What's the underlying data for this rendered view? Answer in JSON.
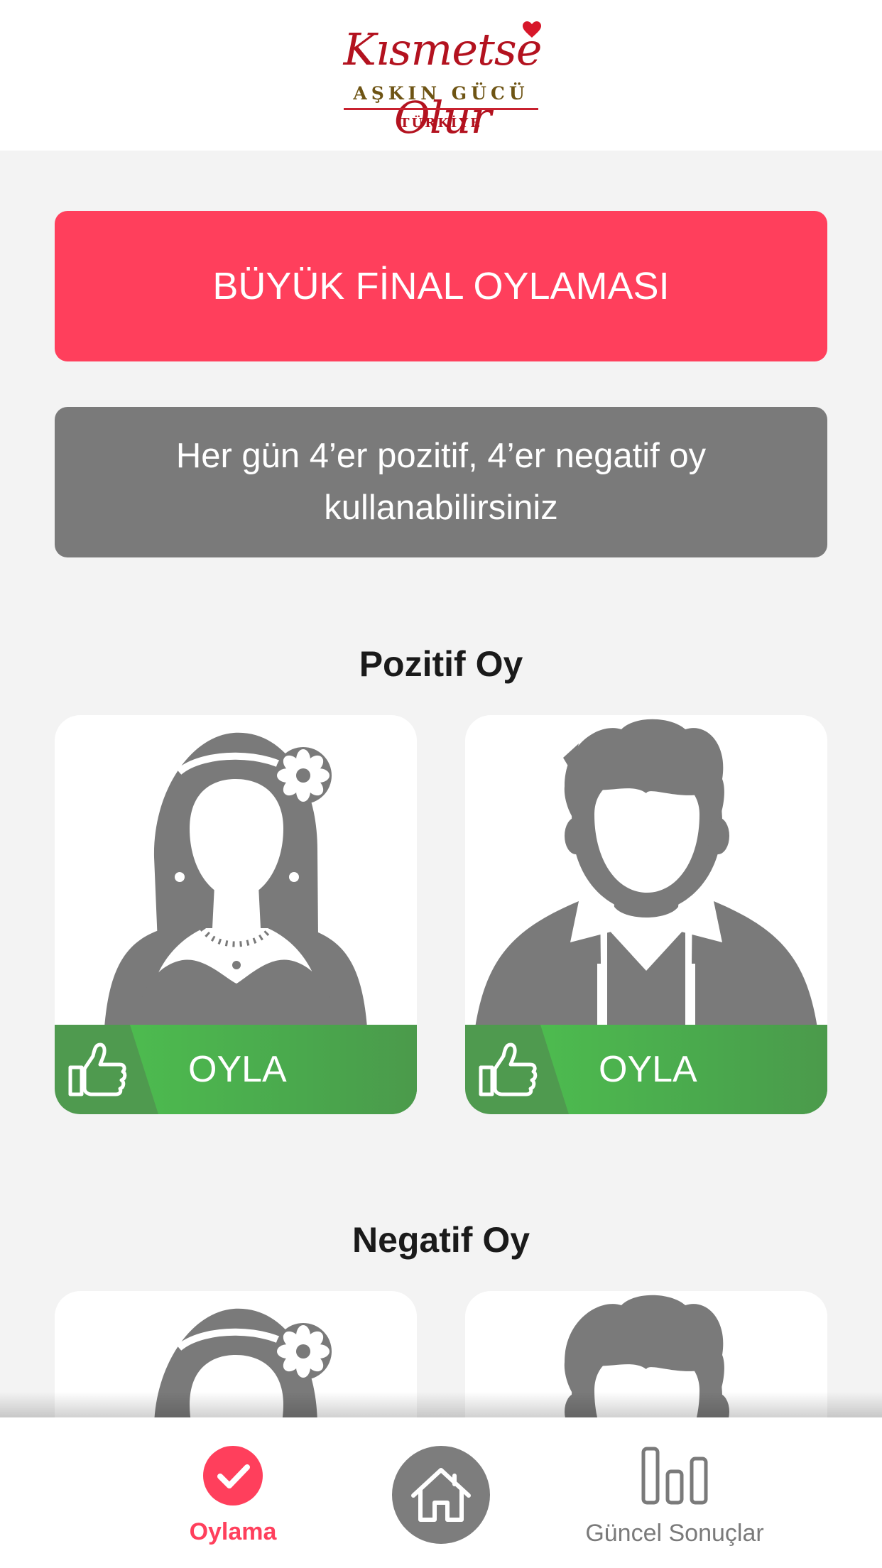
{
  "header": {
    "logo_script": "Kısmetse Olur",
    "logo_subtitle": "AŞKIN GÜCÜ",
    "logo_country": "TÜRKİYE"
  },
  "banner": {
    "title": "BÜYÜK FİNAL OYLAMASI",
    "info": "Her gün 4’er pozitif, 4’er negatif oy kullanabilirsiniz"
  },
  "positive": {
    "title": "Pozitif Oy",
    "cards": [
      {
        "avatar": "female-avatar",
        "vote_label": "OYLA"
      },
      {
        "avatar": "male-avatar",
        "vote_label": "OYLA"
      }
    ]
  },
  "negative": {
    "title": "Negatif Oy",
    "cards": [
      {
        "avatar": "female-avatar"
      },
      {
        "avatar": "male-avatar"
      }
    ]
  },
  "tabbar": {
    "items": [
      {
        "label": "Oylama",
        "icon": "check-icon",
        "active": true
      },
      {
        "label": "",
        "icon": "home-icon",
        "active": false
      },
      {
        "label": "Güncel Sonuçlar",
        "icon": "bar-chart-icon",
        "active": false
      }
    ]
  },
  "colors": {
    "accent": "#ff3f5c",
    "info_gray": "#7a7a7a",
    "vote_green": "#4dbb4f",
    "avatar_gray": "#7a7a7a"
  }
}
